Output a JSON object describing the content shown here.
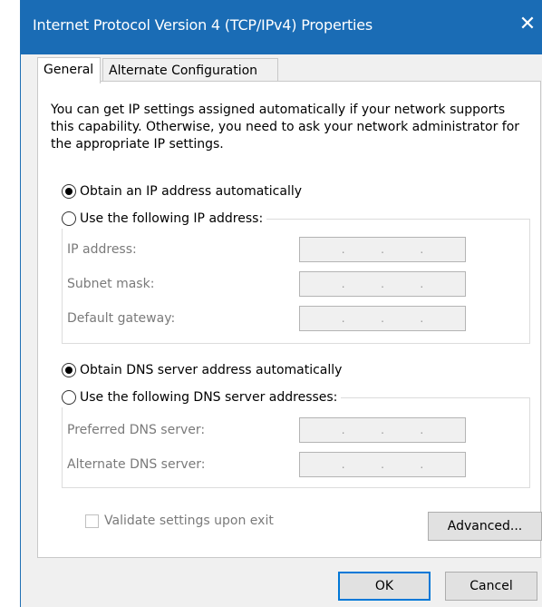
{
  "window": {
    "title": "Internet Protocol Version 4 (TCP/IPv4) Properties",
    "close_symbol": "✕",
    "titlebar_color": "#1a6cb5"
  },
  "tabs": [
    {
      "label": "General",
      "active": true
    },
    {
      "label": "Alternate Configuration",
      "active": false
    }
  ],
  "general": {
    "intro_text": "You can get IP settings assigned automatically if your network supports this capability. Otherwise, you need to ask your network administrator for the appropriate IP settings.",
    "ip_mode": {
      "auto_label": "Obtain an IP address automatically",
      "manual_label": "Use the following IP address:",
      "selected": "auto"
    },
    "ip_fields": [
      {
        "label": "IP address:",
        "value": ". . ."
      },
      {
        "label": "Subnet mask:",
        "value": ". . ."
      },
      {
        "label": "Default gateway:",
        "value": ". . ."
      }
    ],
    "dns_mode": {
      "auto_label": "Obtain DNS server address automatically",
      "manual_label": "Use the following DNS server addresses:",
      "selected": "auto"
    },
    "dns_fields": [
      {
        "label": "Preferred DNS server:",
        "value": ". . ."
      },
      {
        "label": "Alternate DNS server:",
        "value": ". . ."
      }
    ],
    "validate_label": "Validate settings upon exit",
    "validate_checked": false,
    "advanced_label": "Advanced..."
  },
  "footer": {
    "ok_label": "OK",
    "cancel_label": "Cancel"
  }
}
